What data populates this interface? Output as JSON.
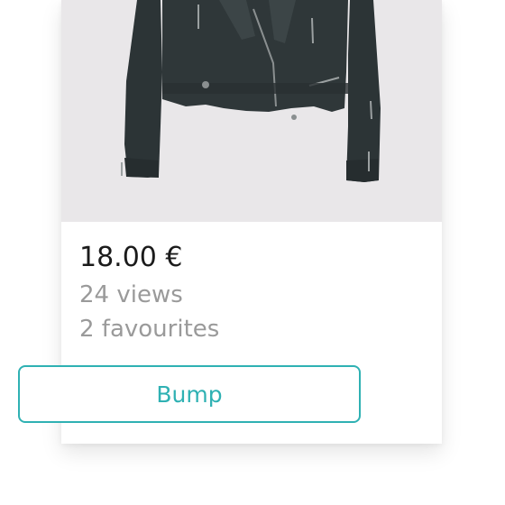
{
  "item": {
    "image_alt": "Black leather biker jacket",
    "price": "18.00 €",
    "views": "24 views",
    "favourites": "2 favourites"
  },
  "actions": {
    "bump_label": "Bump"
  },
  "colors": {
    "accent": "#2fb1b3",
    "price_text": "#1b1b1b",
    "meta_text": "#9a9a9a",
    "photo_background": "#e9e7e9"
  }
}
